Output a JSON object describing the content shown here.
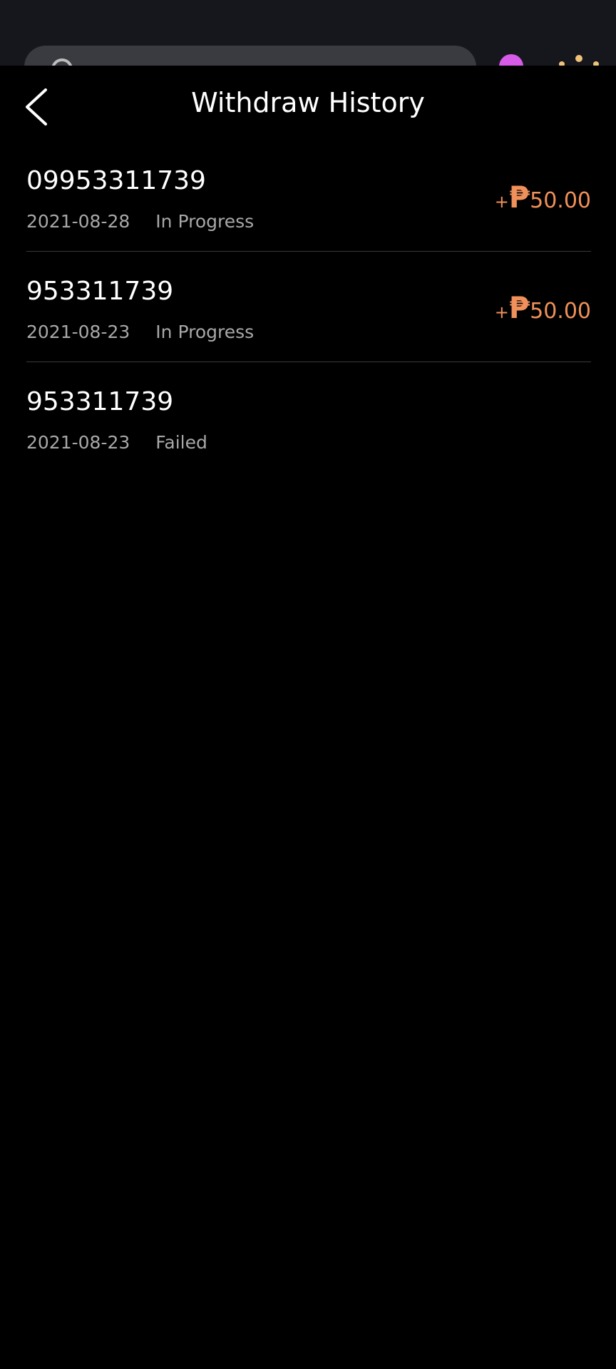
{
  "header": {
    "title": "Withdraw History"
  },
  "colors": {
    "background": "#000000",
    "amount": "#f0905a",
    "meta": "#a8a8a8"
  },
  "icons": {
    "back": "chevron-left-icon"
  },
  "records": [
    {
      "account": "09953311739",
      "date": "2021-08-28",
      "status": "In Progress",
      "sign": "+",
      "currency": "₱",
      "amount": "50.00"
    },
    {
      "account": "953311739",
      "date": "2021-08-23",
      "status": "In Progress",
      "sign": "+",
      "currency": "₱",
      "amount": "50.00"
    },
    {
      "account": "953311739",
      "date": "2021-08-23",
      "status": "Failed",
      "sign": "",
      "currency": "",
      "amount": ""
    }
  ]
}
